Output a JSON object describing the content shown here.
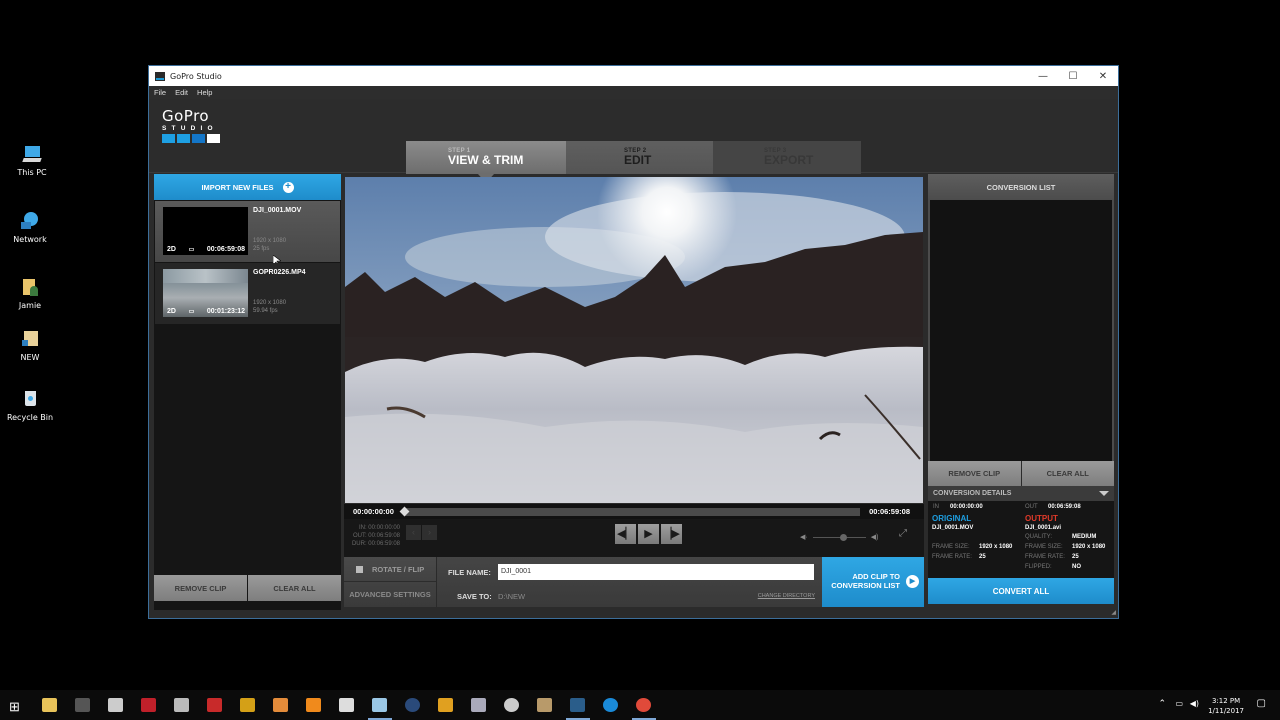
{
  "desktop": {
    "icons": [
      {
        "label": "This PC",
        "icon": "computer-icon"
      },
      {
        "label": "Network",
        "icon": "network-icon"
      },
      {
        "label": "Jamie",
        "icon": "user-folder-icon"
      },
      {
        "label": "NEW",
        "icon": "folder-shortcut-icon"
      },
      {
        "label": "Recycle Bin",
        "icon": "recycle-bin-icon"
      }
    ]
  },
  "window": {
    "title": "GoPro Studio",
    "controls": {
      "minimize": "—",
      "maximize": "☐",
      "close": "✕"
    },
    "menu": [
      "File",
      "Edit",
      "Help"
    ]
  },
  "logo": {
    "brand": "GoPro",
    "product": "STUDIO",
    "squares": [
      "#1ea0e3",
      "#1ea0e3",
      "#1476c8",
      "#ffffff"
    ]
  },
  "steps": [
    {
      "step": "STEP 1",
      "label": "VIEW & TRIM",
      "state": "active"
    },
    {
      "step": "STEP 2",
      "label": "EDIT",
      "state": "inactive"
    },
    {
      "step": "STEP 3",
      "label": "EXPORT",
      "state": "disabled"
    }
  ],
  "media": {
    "import_label": "IMPORT NEW FILES",
    "clips": [
      {
        "name": "DJI_0001.MOV",
        "mode": "2D",
        "duration": "00:06:59:08",
        "resolution": "1920 x 1080",
        "fps": "25 fps",
        "selected": true
      },
      {
        "name": "GOPR0226.MP4",
        "mode": "2D",
        "duration": "00:01:23:12",
        "resolution": "1920 x 1080",
        "fps": "59.94 fps",
        "selected": false
      }
    ],
    "remove_label": "REMOVE CLIP",
    "clear_label": "CLEAR ALL"
  },
  "player": {
    "current_time": "00:00:00:00",
    "total_time": "00:06:59:08",
    "progress": 0,
    "in_label": "IN:",
    "in_value": "00:00:00:00",
    "out_label": "OUT:",
    "out_value": "00:06:59:08",
    "dur_label": "DUR:",
    "dur_value": "00:06:59:08",
    "volume": 0.6
  },
  "options": {
    "rotate_label": "ROTATE / FLIP",
    "rotate_checked": false,
    "advanced_label": "ADVANCED SETTINGS",
    "file_name_label": "FILE NAME:",
    "file_name_value": "DJI_0001",
    "save_to_label": "SAVE TO:",
    "save_to_value": "D:\\NEW",
    "change_dir_label": "CHANGE DIRECTORY",
    "add_clip_line1": "ADD CLIP TO",
    "add_clip_line2": "CONVERSION LIST"
  },
  "conversion": {
    "list_title": "CONVERSION LIST",
    "remove_label": "REMOVE CLIP",
    "clear_label": "CLEAR ALL",
    "details_title": "CONVERSION DETAILS",
    "in_label": "IN",
    "in_value": "00:00:00:00",
    "out_label": "OUT",
    "out_value": "00:06:59:08",
    "original": {
      "heading": "ORIGINAL",
      "file": "DJI_0001.MOV",
      "frame_size_label": "FRAME SIZE:",
      "frame_size": "1920 x 1080",
      "frame_rate_label": "FRAME RATE:",
      "frame_rate": "25"
    },
    "output": {
      "heading": "OUTPUT",
      "file": "DJI_0001.avi",
      "quality_label": "QUALITY:",
      "quality": "MEDIUM",
      "frame_size_label": "FRAME SIZE:",
      "frame_size": "1920 x 1080",
      "frame_rate_label": "FRAME RATE:",
      "frame_rate": "25",
      "flipped_label": "FLIPPED:",
      "flipped": "NO"
    },
    "convert_label": "CONVERT ALL"
  },
  "taskbar": {
    "apps": [
      "start",
      "file-explorer",
      "game-controller",
      "steam-client",
      "geforce",
      "notepad-n",
      "game-4",
      "rockstar",
      "paint-app",
      "vlc",
      "calculator",
      "notepad",
      "steam",
      "app-orange",
      "paint-brush",
      "webcam",
      "app-clip",
      "gopro-studio",
      "quicktime",
      "chrome"
    ],
    "time": "3:12 PM",
    "date": "1/11/2017"
  }
}
